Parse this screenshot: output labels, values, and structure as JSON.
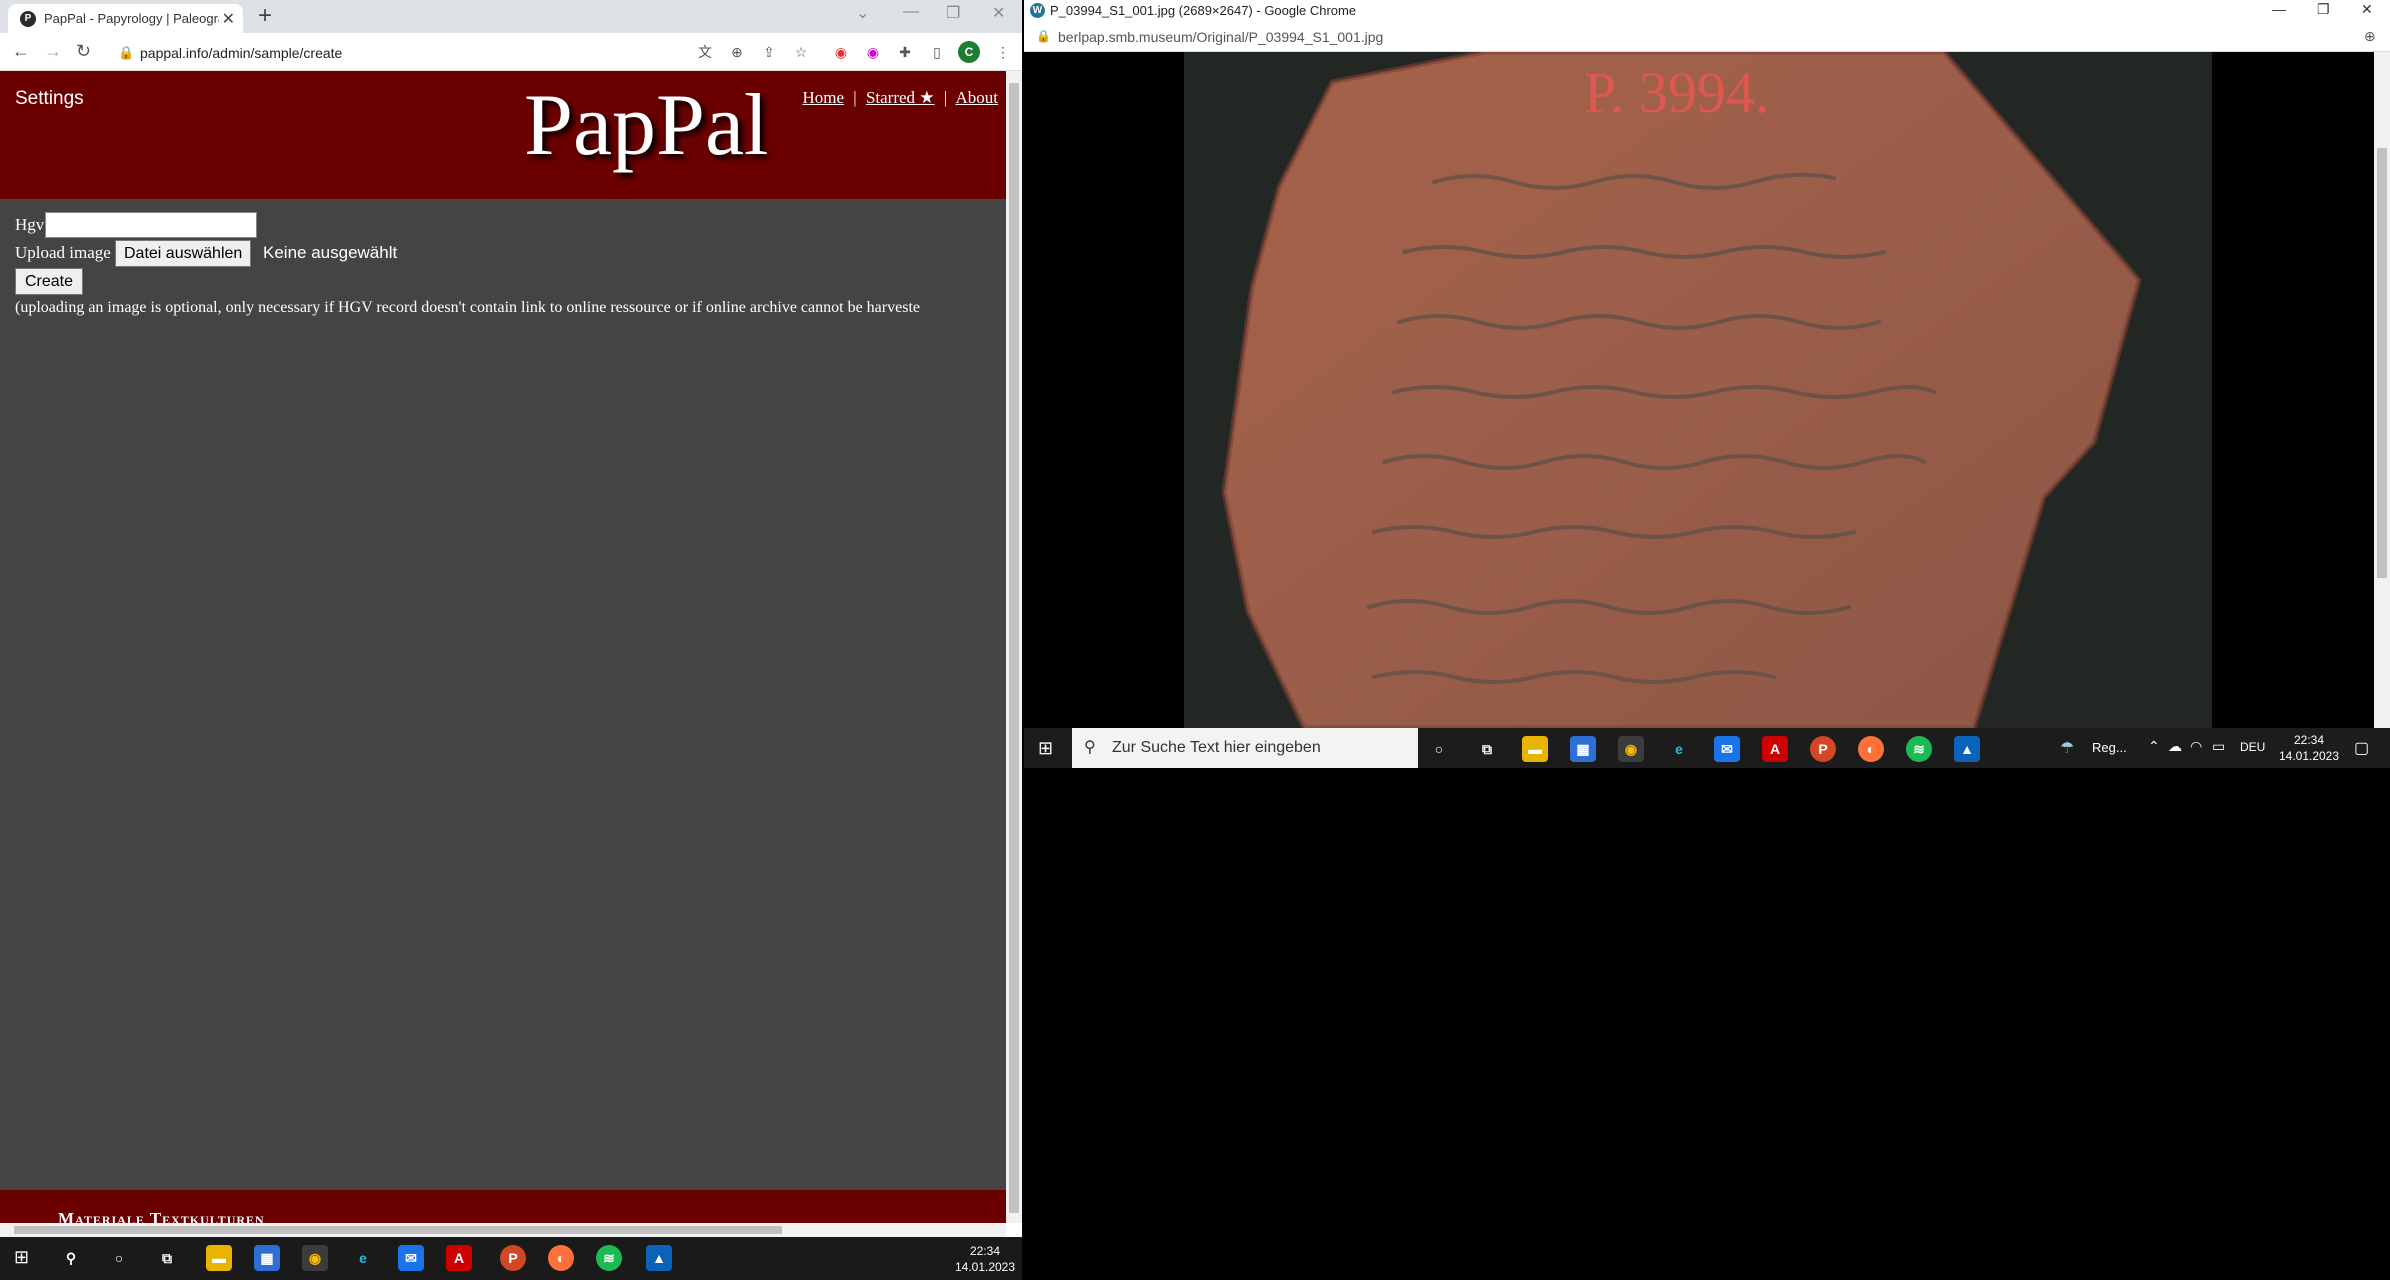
{
  "left_window": {
    "tab_title": "PapPal - Papyrology | Paleograph",
    "tab_favicon": "P",
    "url": "pappal.info/admin/sample/create",
    "profile_initial": "C",
    "page": {
      "settings": "Settings",
      "logo": "PapPal",
      "nav": {
        "home": "Home",
        "starred": "Starred ★",
        "about": "About",
        "sep": "|"
      },
      "hgv_label": "Hgv",
      "upload_label": "Upload image",
      "file_button": "Datei auswählen",
      "no_file": "Keine ausgewählt",
      "create_button": "Create",
      "note": "(uploading an image is optional, only necessary if HGV record doesn't contain link to online ressource or if online archive cannot be harveste",
      "footer": "Materiale Textkulturen"
    }
  },
  "right_window": {
    "title": "P_03994_S1_001.jpg (2689×2647) - Google Chrome",
    "url": "berlpap.smb.museum/Original/P_03994_S1_001.jpg",
    "image": {
      "inventory_mark": "P. 3994."
    }
  },
  "taskbar_right": {
    "search_placeholder": "Zur Suche Text hier eingeben",
    "weather": "Reg...",
    "lang": "DEU",
    "time": "22:34",
    "date": "14.01.2023"
  },
  "taskbar_left": {
    "time": "22:34",
    "date": "14.01.2023"
  },
  "colors": {
    "header_red": "#6b0000",
    "page_gray": "#444444"
  }
}
